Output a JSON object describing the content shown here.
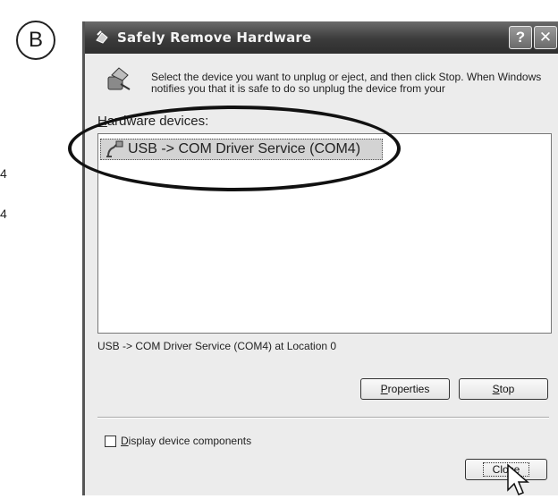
{
  "step_badge": "B",
  "margin_text": [
    "4",
    "4"
  ],
  "window": {
    "title": "Safely Remove Hardware",
    "help_button": "?",
    "close_button": "✕",
    "instruction": "Select the device you want to unplug or eject, and then click Stop. When Windows notifies you that it is safe to do so unplug the device from your",
    "hardware_devices_label_accel": "H",
    "hardware_devices_label_rest": "ardware devices:",
    "devices": [
      "USB -> COM Driver Service (COM4)"
    ],
    "location_text": "USB -> COM Driver Service (COM4) at Location 0",
    "properties_accel": "P",
    "properties_rest": "roperties",
    "stop_accel": "S",
    "stop_rest": "top",
    "display_components_accel": "D",
    "display_components_rest": "isplay device components",
    "display_components_checked": false,
    "close_label": "Close"
  },
  "icons": {
    "title": "remove-hardware-icon",
    "instruction": "eject-hardware-icon",
    "device": "usb-plug-icon",
    "cursor": "mouse-pointer-icon"
  }
}
